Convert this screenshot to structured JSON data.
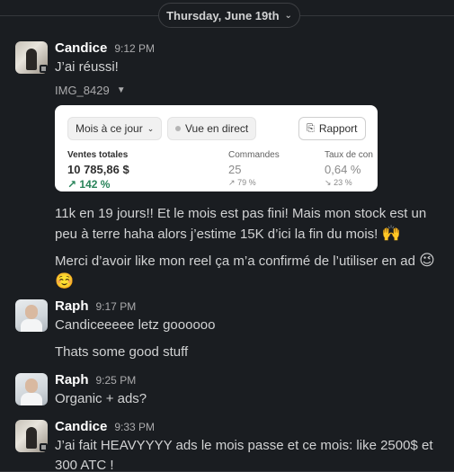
{
  "date_divider": {
    "label": "Thursday, June 19th"
  },
  "messages": [
    {
      "author": "Candice",
      "time": "9:12 PM",
      "text": "J’ai réussi!"
    },
    {
      "author": "Raph",
      "time": "9:17 PM",
      "text": "Candiceeeee letz goooooo",
      "followup": "Thats some good stuff"
    },
    {
      "author": "Raph",
      "time": "9:25 PM",
      "text": "Organic + ads?"
    },
    {
      "author": "Candice",
      "time": "9:33 PM",
      "text": "J’ai fait HEAVYYYY ads le mois passe et ce mois: like 2500$ et 300 ATC !"
    }
  ],
  "attachment": {
    "file_name": "IMG_8429",
    "preview": {
      "month_button": "Mois à ce jour",
      "live_button": "Vue en direct",
      "report_button": "Rapport",
      "stats": [
        {
          "label": "Ventes totales",
          "value": "10 785,86 $",
          "change": "142 %"
        },
        {
          "label": "Commandes",
          "value": "25",
          "change": "79 %"
        },
        {
          "label": "Taux de con",
          "value": "0,64 %",
          "change": "23 %"
        }
      ]
    }
  },
  "candice_extra": {
    "paragraph1": "11k en 19 jours!! Et le mois est pas fini! Mais mon stock est un peu à terre haha alors j’estime 15K d’ici la fin du mois!",
    "paragraph1_emoji": "🙌",
    "paragraph2": "Merci d’avoir like mon reel ça m’a confirmé de l’utiliser en ad",
    "paragraph2_emoji": "😉",
    "paragraph2_emoji2": "☺️"
  },
  "colors": {
    "background": "#1a1d21",
    "text": "#d1d2d3",
    "name": "#ffffff",
    "positive": "#29845a"
  }
}
